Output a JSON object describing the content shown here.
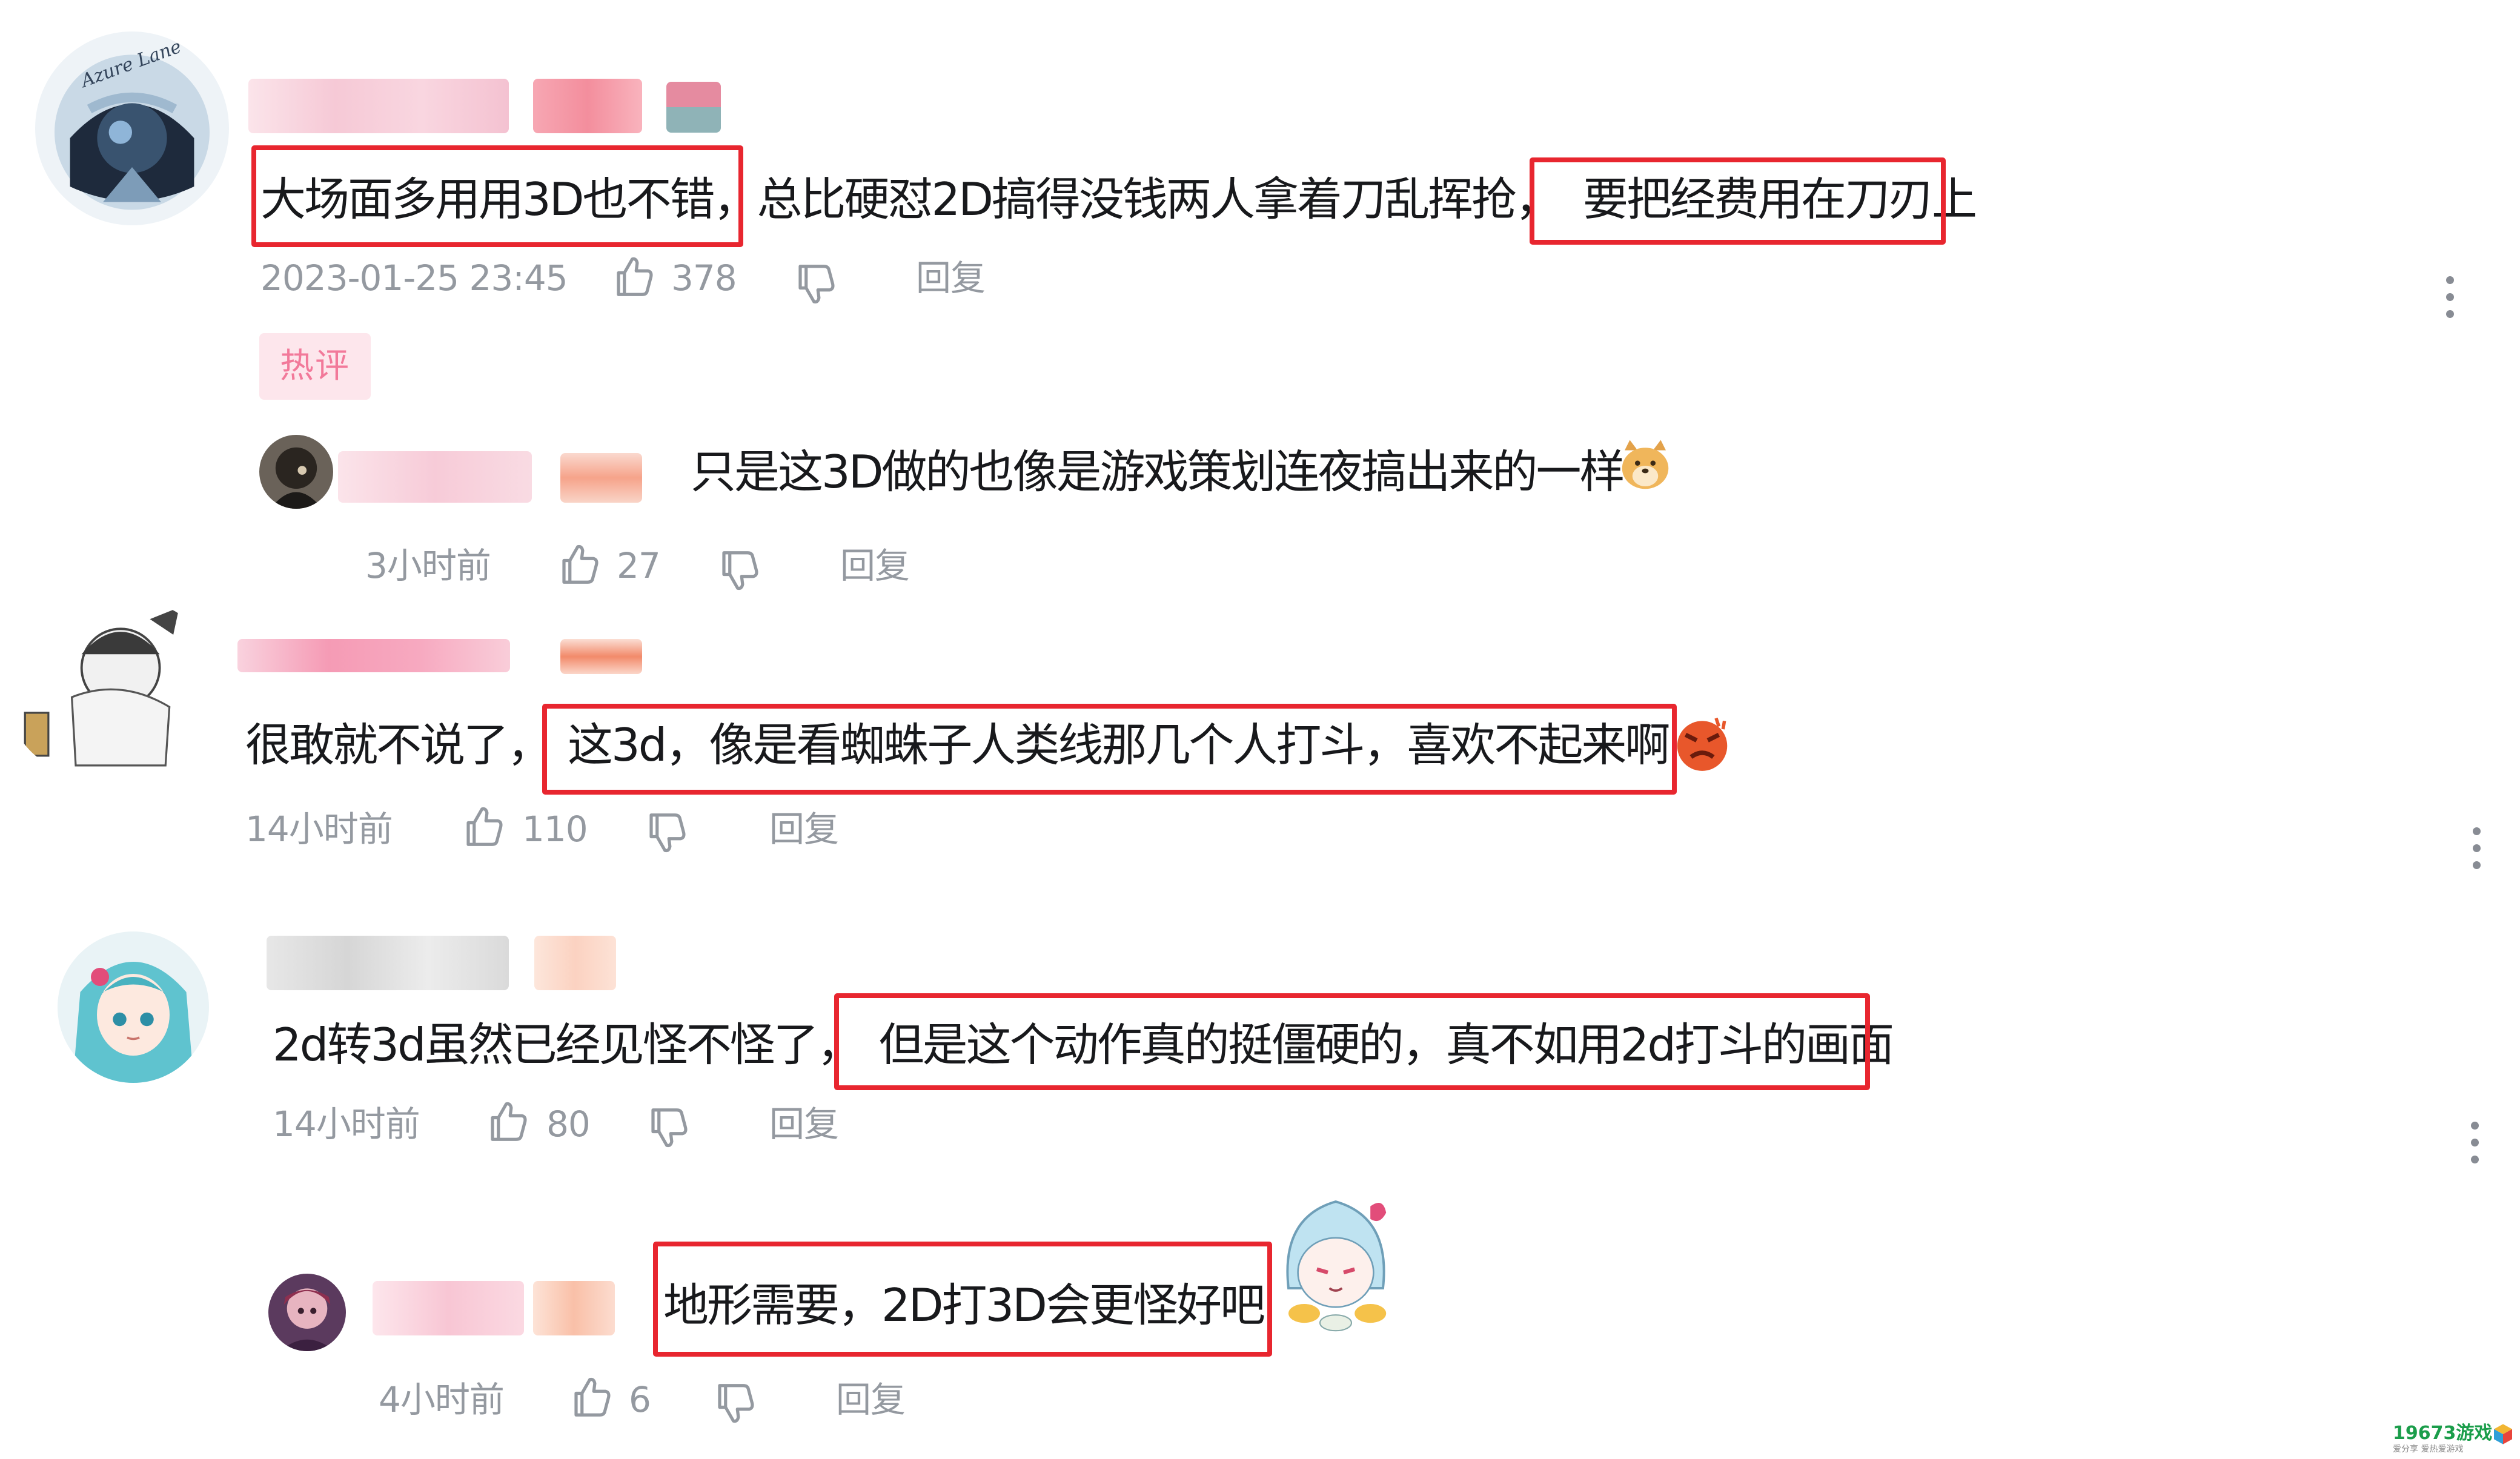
{
  "comments": [
    {
      "text_before": "大场面多用用3D也不错，",
      "text_middle": "总比硬怼2D搞得没钱两人拿着刀乱挥抢，",
      "text_after": "要把经费用在刀刃上",
      "time": "2023-01-25 23:45",
      "likes": "378",
      "reply_label": "回复",
      "tag": "热评"
    },
    {
      "text": "只是这3D做的也像是游戏策划连夜搞出来的一样",
      "time": "3小时前",
      "likes": "27",
      "reply_label": "回复"
    },
    {
      "text_before": "很敢就不说了，",
      "text_highlight": "这3d，像是看蜘蛛子人类线那几个人打斗，喜欢不起来啊",
      "time": "14小时前",
      "likes": "110",
      "reply_label": "回复"
    },
    {
      "text_before": "2d转3d虽然已经见怪不怪了，",
      "text_highlight": "但是这个动作真的挺僵硬的，真不如用2d打斗的画面",
      "time": "14小时前",
      "likes": "80",
      "reply_label": "回复"
    },
    {
      "text_highlight": "地形需要，2D打3D会更怪好吧",
      "time": "4小时前",
      "likes": "6",
      "reply_label": "回复"
    }
  ],
  "avatar_badge_text": "Azure Lane",
  "watermark": {
    "brand": "19673游戏",
    "slogan": "爱分享 爱热爱游戏"
  },
  "colors": {
    "highlight_border": "#e8262f",
    "meta_text": "#9499a0",
    "tag_bg": "#fde6ec",
    "tag_text": "#f2799a",
    "blur_pink": "#f8c6d4",
    "blur_salmon": "#f6a38a",
    "blur_gray": "#dcdcdc"
  }
}
